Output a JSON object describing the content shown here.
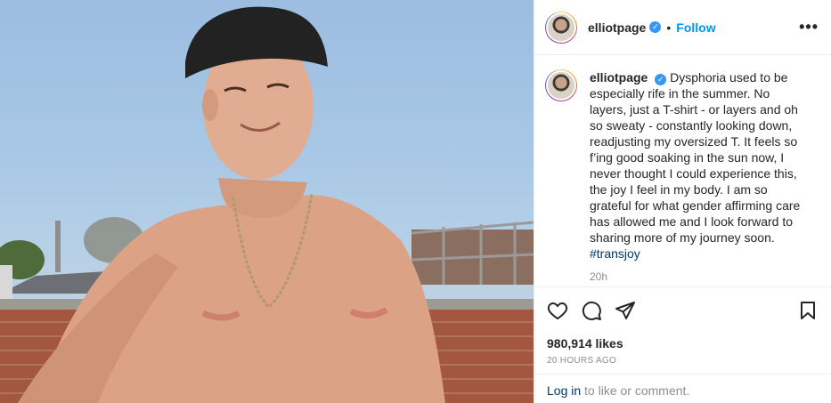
{
  "post": {
    "username": "elliotpage",
    "follow_label": "Follow",
    "separator": "•",
    "more_label": "•••",
    "caption": "Dysphoria used to be especially rife in the summer. No layers, just a T-shirt - or layers and oh so sweaty - constantly looking down, readjusting my oversized T. It feels so f’ing good soaking in the sun now, I never thought I could experience this, the joy I feel in my body. I am so grateful for what gender affirming care has allowed me and I look forward to sharing more of my journey soon.",
    "hashtag": "#transjoy",
    "time_ago": "20h",
    "likes": "980,914 likes",
    "posted_ago": "20 HOURS AGO",
    "login_link": "Log in",
    "login_suffix": " to like or comment."
  },
  "icons": {
    "verified": "verified-badge-icon",
    "like": "heart-icon",
    "comment": "comment-icon",
    "share": "paper-plane-icon",
    "save": "bookmark-icon"
  },
  "colors": {
    "accent": "#0095f6",
    "verified": "#3897f0",
    "hashtag": "#00376b",
    "muted": "#8e8e8e"
  }
}
